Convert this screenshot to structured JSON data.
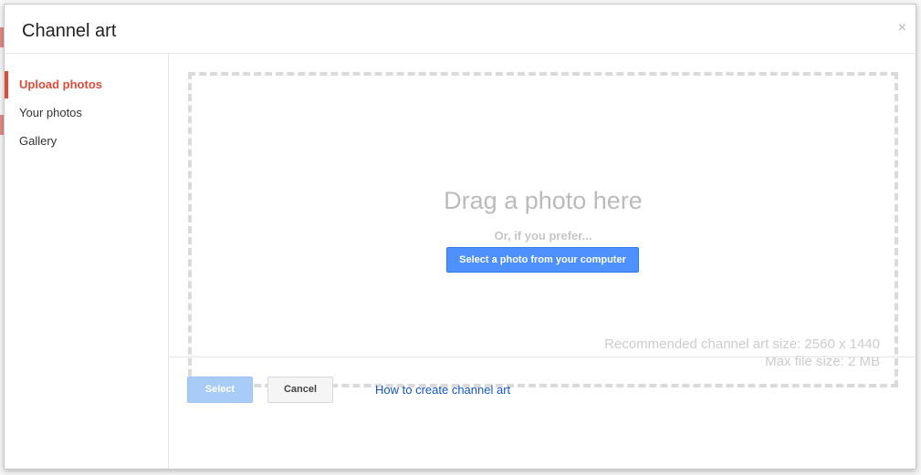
{
  "dialog": {
    "title": "Channel art",
    "close_symbol": "×"
  },
  "sidebar": {
    "items": [
      {
        "label": "Upload photos",
        "active": true
      },
      {
        "label": "Your photos",
        "active": false
      },
      {
        "label": "Gallery",
        "active": false
      }
    ]
  },
  "dropzone": {
    "drag_text": "Drag a photo here",
    "prefer_text": "Or, if you prefer...",
    "select_button_label": "Select a photo from your computer",
    "recommended_size": "Recommended channel art size: 2560 x 1440",
    "max_file_size": "Max file size: 2 MB"
  },
  "footer": {
    "select_label": "Select",
    "cancel_label": "Cancel",
    "howto_link": "How to create channel art"
  },
  "colors": {
    "accent_red": "#dd4b39",
    "primary_blue": "#4d90fe",
    "link_blue": "#1155cc",
    "disabled_blue": "#a9cbf8"
  }
}
